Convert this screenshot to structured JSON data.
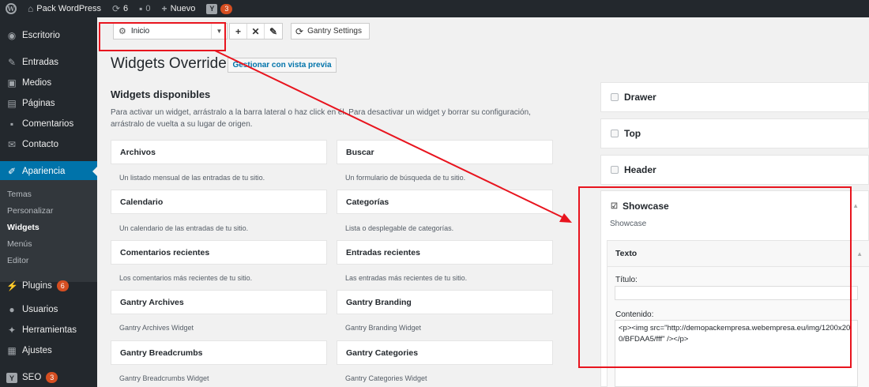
{
  "adminbar": {
    "site_name": "Pack WordPress",
    "updates_count": "6",
    "comments_count": "0",
    "new_label": "Nuevo",
    "seo_badge": "3"
  },
  "sidebar": {
    "items": [
      {
        "label": "Escritorio",
        "icon": "dashboard-icon"
      },
      {
        "label": "Entradas",
        "icon": "pin-icon"
      },
      {
        "label": "Medios",
        "icon": "media-icon"
      },
      {
        "label": "Páginas",
        "icon": "pages-icon"
      },
      {
        "label": "Comentarios",
        "icon": "comment-icon"
      },
      {
        "label": "Contacto",
        "icon": "mail-icon"
      },
      {
        "label": "Apariencia",
        "icon": "brush-icon"
      },
      {
        "label": "Plugins",
        "icon": "plugin-icon",
        "badge": "6"
      },
      {
        "label": "Usuarios",
        "icon": "user-icon"
      },
      {
        "label": "Herramientas",
        "icon": "wrench-icon"
      },
      {
        "label": "Ajustes",
        "icon": "settings-icon"
      },
      {
        "label": "SEO",
        "icon": "yoast-icon",
        "badge": "3"
      }
    ],
    "submenu": [
      "Temas",
      "Personalizar",
      "Widgets",
      "Menús",
      "Editor"
    ]
  },
  "toolbar": {
    "select_value": "Inicio",
    "gantry_settings": "Gantry Settings"
  },
  "page": {
    "title": "Widgets Override",
    "preview_button": "Gestionar con vista previa",
    "available_title": "Widgets disponibles",
    "available_desc": "Para activar un widget, arrástralo a la barra lateral o haz click en él. Para desactivar un widget y borrar su configuración, arrástralo de vuelta a su lugar de origen."
  },
  "widgets": [
    {
      "name": "Archivos",
      "desc": "Un listado mensual de las entradas de tu sitio."
    },
    {
      "name": "Buscar",
      "desc": "Un formulario de búsqueda de tu sitio."
    },
    {
      "name": "Calendario",
      "desc": "Un calendario de las entradas de tu sitio."
    },
    {
      "name": "Categorías",
      "desc": "Lista o desplegable de categorías."
    },
    {
      "name": "Comentarios recientes",
      "desc": "Los comentarios más recientes de tu sitio."
    },
    {
      "name": "Entradas recientes",
      "desc": "Las entradas más recientes de tu sitio."
    },
    {
      "name": "Gantry Archives",
      "desc": "Gantry Archives Widget"
    },
    {
      "name": "Gantry Branding",
      "desc": "Gantry Branding Widget"
    },
    {
      "name": "Gantry Breadcrumbs",
      "desc": "Gantry Breadcrumbs Widget"
    },
    {
      "name": "Gantry Categories",
      "desc": "Gantry Categories Widget"
    }
  ],
  "sidebars": {
    "drawer": "Drawer",
    "top": "Top",
    "header": "Header",
    "showcase": "Showcase",
    "showcase_desc": "Showcase",
    "texto_widget": {
      "title": "Texto",
      "titulo_label": "Título:",
      "titulo_value": "",
      "contenido_label": "Contenido:",
      "contenido_value": "<p><img src=\"http://demopackempresa.webempresa.eu/img/1200x200/BFDAA5/fff\" /></p>"
    }
  },
  "colors": {
    "admin_dark": "#23282d",
    "active_blue": "#0073aa",
    "badge_orange": "#d54e21",
    "annotation_red": "#e8141e"
  }
}
